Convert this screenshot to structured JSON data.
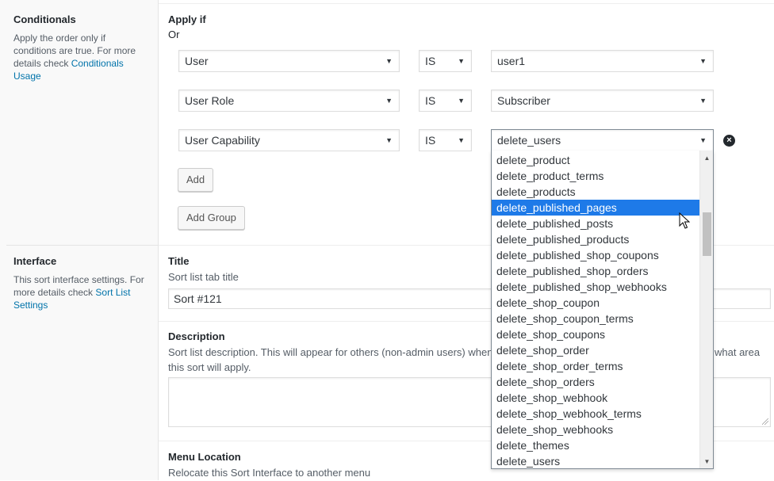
{
  "conditionals": {
    "title": "Conditionals",
    "desc_prefix": "Apply the order only if conditions are true. For more details check ",
    "desc_link": "Conditionals Usage",
    "apply_if": "Apply if",
    "or": "Or",
    "rows": [
      {
        "field": "User",
        "operator": "IS",
        "value": "user1"
      },
      {
        "field": "User Role",
        "operator": "IS",
        "value": "Subscriber"
      },
      {
        "field": "User Capability",
        "operator": "IS",
        "value": "delete_users"
      }
    ],
    "add_label": "Add",
    "add_group_label": "Add Group"
  },
  "interface": {
    "title": "Interface",
    "desc_prefix": "This sort interface settings. For more details check ",
    "desc_link": "Sort List Settings",
    "title_label": "Title",
    "title_help": "Sort list tab title",
    "title_value": "Sort #121",
    "description_label": "Description",
    "description_help_left": "Sort list description. This will appear for others (non-admin users) when",
    "description_help_right": "what area",
    "description_help_line2": "this sort will apply.",
    "menu_location_label": "Menu Location",
    "menu_location_help": "Relocate this Sort Interface to another menu"
  },
  "dropdown": {
    "options": [
      "delete_product",
      "delete_product_terms",
      "delete_products",
      "delete_published_pages",
      "delete_published_posts",
      "delete_published_products",
      "delete_published_shop_coupons",
      "delete_published_shop_orders",
      "delete_published_shop_webhooks",
      "delete_shop_coupon",
      "delete_shop_coupon_terms",
      "delete_shop_coupons",
      "delete_shop_order",
      "delete_shop_order_terms",
      "delete_shop_orders",
      "delete_shop_webhook",
      "delete_shop_webhook_terms",
      "delete_shop_webhooks",
      "delete_themes",
      "delete_users"
    ],
    "highlighted": "delete_published_pages"
  },
  "icons": {
    "caret": "caret-down-icon",
    "remove": "remove-circle-icon",
    "cursor": "mouse-pointer-icon"
  },
  "colors": {
    "link": "#0073aa",
    "highlight": "#1e7ae8"
  }
}
